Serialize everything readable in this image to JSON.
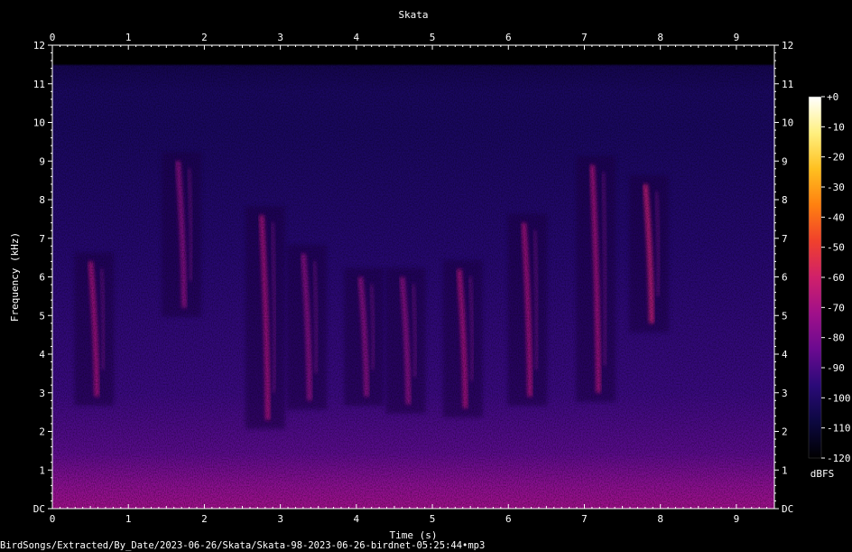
{
  "chart_data": {
    "type": "heatmap",
    "title": "Skata",
    "xlabel": "Time (s)",
    "ylabel": "Frequency (kHz)",
    "xlim": [
      0,
      9.5
    ],
    "ylim": [
      0,
      12
    ],
    "x_ticks": [
      "0",
      "1",
      "2",
      "3",
      "4",
      "5",
      "6",
      "7",
      "8",
      "9"
    ],
    "y_ticks": [
      "DC",
      "1",
      "2",
      "3",
      "4",
      "5",
      "6",
      "7",
      "8",
      "9",
      "10",
      "11",
      "12"
    ],
    "colorbar": {
      "label": "dBFS",
      "range": [
        -120,
        0
      ],
      "ticks": [
        "+0",
        "-10",
        "-20",
        "-30",
        "-40",
        "-50",
        "-60",
        "-70",
        "-80",
        "-90",
        "-100",
        "-110",
        "-120"
      ],
      "colors": [
        "#000000",
        "#0c0840",
        "#2a0a78",
        "#6a0a90",
        "#a0108a",
        "#d0206a",
        "#f0402c",
        "#ff8010",
        "#ffc020",
        "#fff080",
        "#ffffff"
      ]
    },
    "calls": [
      {
        "t": 0.55,
        "f_low": 2.9,
        "f_high": 6.4,
        "level": -70
      },
      {
        "t": 1.7,
        "f_low": 5.2,
        "f_high": 9.0,
        "level": -80
      },
      {
        "t": 2.8,
        "f_low": 2.3,
        "f_high": 7.6,
        "level": -75
      },
      {
        "t": 3.35,
        "f_low": 2.8,
        "f_high": 6.6,
        "level": -78
      },
      {
        "t": 4.1,
        "f_low": 2.9,
        "f_high": 6.0,
        "level": -76
      },
      {
        "t": 4.65,
        "f_low": 2.7,
        "f_high": 6.0,
        "level": -80
      },
      {
        "t": 5.4,
        "f_low": 2.6,
        "f_high": 6.2,
        "level": -74
      },
      {
        "t": 6.25,
        "f_low": 2.9,
        "f_high": 7.4,
        "level": -72
      },
      {
        "t": 7.15,
        "f_low": 3.0,
        "f_high": 8.9,
        "level": -74
      },
      {
        "t": 7.85,
        "f_low": 4.8,
        "f_high": 8.4,
        "level": -66
      }
    ]
  },
  "caption": "BirdSongs/Extracted/By_Date/2023-06-26/Skata/Skata-98-2023-06-26-birdnet-05:25:44•mp3"
}
